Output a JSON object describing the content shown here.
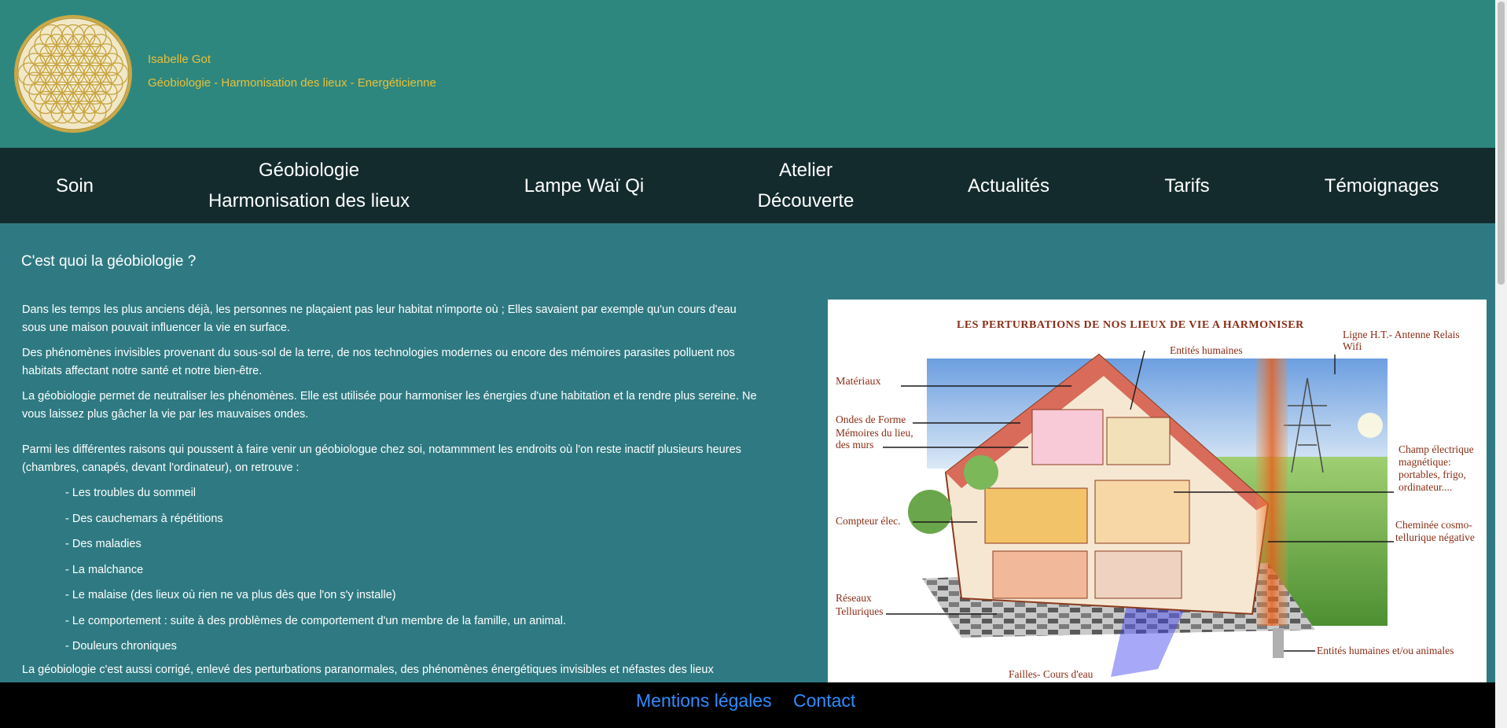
{
  "header": {
    "site_name": "Isabelle Got",
    "tagline": "Géobiologie - Harmonisation des lieux - Energéticienne"
  },
  "nav": {
    "items": [
      {
        "line1": "Soin",
        "line2": ""
      },
      {
        "line1": "Géobiologie",
        "line2": "Harmonisation des lieux"
      },
      {
        "line1": "Lampe Waï Qi",
        "line2": ""
      },
      {
        "line1": "Atelier",
        "line2": "Découverte"
      },
      {
        "line1": "Actualités",
        "line2": ""
      },
      {
        "line1": "Tarifs",
        "line2": ""
      },
      {
        "line1": "Témoignages",
        "line2": ""
      }
    ]
  },
  "main": {
    "title": "C'est quoi la géobiologie ?",
    "paragraphs": [
      "Dans les temps les plus anciens déjà, les personnes ne plaçaient pas leur habitat n'importe où ; Elles savaient par exemple qu'un cours d'eau sous une maison pouvait influencer la vie en surface.",
      "Des phénomènes invisibles provenant du sous-sol de la terre, de nos technologies modernes ou encore des mémoires parasites polluent nos habitats affectant notre santé et notre bien-être.",
      "La géobiologie permet de neutraliser les phénomènes. Elle est utilisée pour harmoniser les énergies d'une habitation et la rendre plus sereine. Ne vous laissez plus gâcher la vie par les mauvaises ondes.",
      "Parmi les différentes raisons qui poussent à faire venir un géobiologue chez soi, notammment les endroits où l'on reste inactif plusieurs heures (chambres, canapés, devant l'ordinateur), on retrouve :"
    ],
    "list": [
      "- Les troubles du sommeil",
      "- Des cauchemars à répétitions",
      "- Des maladies",
      "- La malchance",
      "- Le malaise (des lieux où rien ne va plus dès que l'on s'y installe)",
      "- Le comportement : suite à des problèmes de comportement d'un membre de la famille, un animal.",
      "- Douleurs chroniques"
    ],
    "closing": "La géobiologie c'est aussi corrigé, enlevé des perturbations paranormales, des phénomènes énergétiques invisibles et néfastes des lieux"
  },
  "figure": {
    "title": "LES PERTURBATIONS DE NOS LIEUX DE VIE A HARMONISER",
    "labels": {
      "materiaux": "Matériaux",
      "entites": "Entités humaines",
      "ligne_1": "Ligne H.T.- Antenne Relais",
      "ligne_2": "Wifi",
      "ondes": "Ondes de Forme",
      "memoires_1": "Mémoires du lieu,",
      "memoires_2": "des murs",
      "champ_1": "Champ électrique",
      "champ_2": "magnétique:",
      "champ_3": "portables, frigo,",
      "champ_4": "ordinateur....",
      "compteur": "Compteur élec.",
      "cheminee_1": "Cheminée cosmo-",
      "cheminee_2": "tellurique négative",
      "reseaux_1": "Réseaux",
      "reseaux_2": "Telluriques",
      "entites_animales": "Entités humaines et/ou animales",
      "failles": "Failles- Cours d'eau"
    }
  },
  "footer": {
    "mentions": "Mentions légales",
    "contact": "Contact"
  },
  "colors": {
    "header_bg": "#2e877e",
    "nav_bg": "#142b2d",
    "body_bg": "#2f7a82",
    "accent_gold": "#e8c03a",
    "link_blue": "#2f8cff"
  }
}
